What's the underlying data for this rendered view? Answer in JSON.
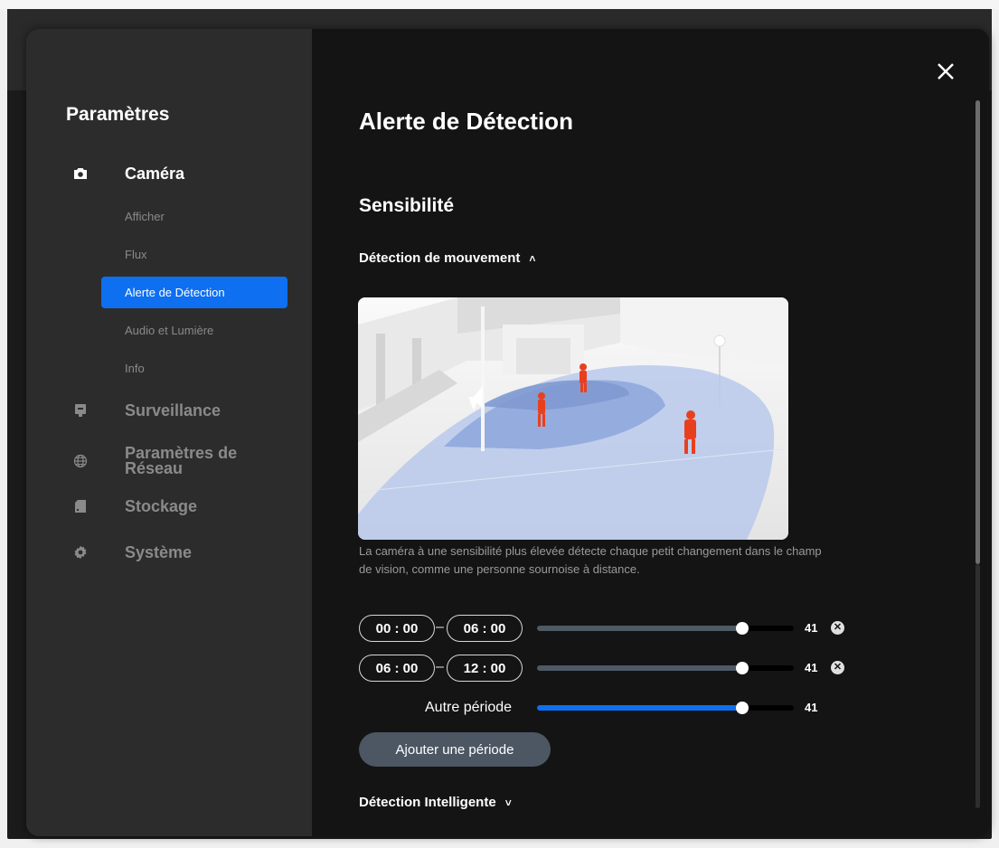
{
  "sidebar": {
    "title": "Paramètres",
    "groups": [
      {
        "label": "Caméra",
        "icon": "camera-icon"
      },
      {
        "label": "Surveillance",
        "icon": "monitor-icon"
      },
      {
        "label": "Paramètres de Réseau",
        "icon": "globe-icon"
      },
      {
        "label": "Stockage",
        "icon": "storage-icon"
      },
      {
        "label": "Système",
        "icon": "gear-icon"
      }
    ],
    "camera_items": [
      {
        "label": "Afficher"
      },
      {
        "label": "Flux"
      },
      {
        "label": "Alerte de Détection",
        "active": true
      },
      {
        "label": "Audio et Lumière"
      },
      {
        "label": "Info"
      }
    ]
  },
  "main": {
    "title": "Alerte de Détection",
    "section": "Sensibilité",
    "motion": {
      "label": "Détection de mouvement",
      "expanded": true,
      "description": "La caméra à une sensibilité plus élevée détecte chaque petit changement dans le champ de vision, comme une personne sournoise à distance.",
      "periods": [
        {
          "start": "00 : 00",
          "end": "06 : 00",
          "value": "41",
          "level": 0.8
        },
        {
          "start": "06 : 00",
          "end": "12 : 00",
          "value": "41",
          "level": 0.8
        }
      ],
      "other": {
        "label": "Autre période",
        "value": "41",
        "level": 0.8
      },
      "add_label": "Ajouter une période"
    },
    "smart": {
      "label": "Détection Intelligente",
      "expanded": false
    }
  },
  "colors": {
    "accent": "#0e6ff0",
    "sidebar_bg": "#2c2c2c",
    "main_bg": "#141414"
  }
}
